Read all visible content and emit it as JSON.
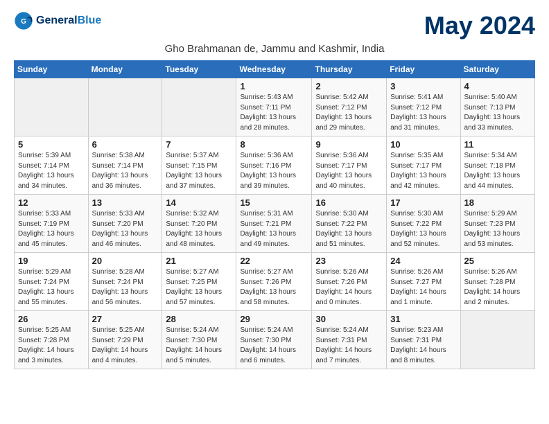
{
  "logo": {
    "general": "General",
    "blue": "Blue"
  },
  "title": "May 2024",
  "subtitle": "Gho Brahmanan de, Jammu and Kashmir, India",
  "days_of_week": [
    "Sunday",
    "Monday",
    "Tuesday",
    "Wednesday",
    "Thursday",
    "Friday",
    "Saturday"
  ],
  "weeks": [
    [
      {
        "day": "",
        "info": ""
      },
      {
        "day": "",
        "info": ""
      },
      {
        "day": "",
        "info": ""
      },
      {
        "day": "1",
        "info": "Sunrise: 5:43 AM\nSunset: 7:11 PM\nDaylight: 13 hours\nand 28 minutes."
      },
      {
        "day": "2",
        "info": "Sunrise: 5:42 AM\nSunset: 7:12 PM\nDaylight: 13 hours\nand 29 minutes."
      },
      {
        "day": "3",
        "info": "Sunrise: 5:41 AM\nSunset: 7:12 PM\nDaylight: 13 hours\nand 31 minutes."
      },
      {
        "day": "4",
        "info": "Sunrise: 5:40 AM\nSunset: 7:13 PM\nDaylight: 13 hours\nand 33 minutes."
      }
    ],
    [
      {
        "day": "5",
        "info": "Sunrise: 5:39 AM\nSunset: 7:14 PM\nDaylight: 13 hours\nand 34 minutes."
      },
      {
        "day": "6",
        "info": "Sunrise: 5:38 AM\nSunset: 7:14 PM\nDaylight: 13 hours\nand 36 minutes."
      },
      {
        "day": "7",
        "info": "Sunrise: 5:37 AM\nSunset: 7:15 PM\nDaylight: 13 hours\nand 37 minutes."
      },
      {
        "day": "8",
        "info": "Sunrise: 5:36 AM\nSunset: 7:16 PM\nDaylight: 13 hours\nand 39 minutes."
      },
      {
        "day": "9",
        "info": "Sunrise: 5:36 AM\nSunset: 7:17 PM\nDaylight: 13 hours\nand 40 minutes."
      },
      {
        "day": "10",
        "info": "Sunrise: 5:35 AM\nSunset: 7:17 PM\nDaylight: 13 hours\nand 42 minutes."
      },
      {
        "day": "11",
        "info": "Sunrise: 5:34 AM\nSunset: 7:18 PM\nDaylight: 13 hours\nand 44 minutes."
      }
    ],
    [
      {
        "day": "12",
        "info": "Sunrise: 5:33 AM\nSunset: 7:19 PM\nDaylight: 13 hours\nand 45 minutes."
      },
      {
        "day": "13",
        "info": "Sunrise: 5:33 AM\nSunset: 7:20 PM\nDaylight: 13 hours\nand 46 minutes."
      },
      {
        "day": "14",
        "info": "Sunrise: 5:32 AM\nSunset: 7:20 PM\nDaylight: 13 hours\nand 48 minutes."
      },
      {
        "day": "15",
        "info": "Sunrise: 5:31 AM\nSunset: 7:21 PM\nDaylight: 13 hours\nand 49 minutes."
      },
      {
        "day": "16",
        "info": "Sunrise: 5:30 AM\nSunset: 7:22 PM\nDaylight: 13 hours\nand 51 minutes."
      },
      {
        "day": "17",
        "info": "Sunrise: 5:30 AM\nSunset: 7:22 PM\nDaylight: 13 hours\nand 52 minutes."
      },
      {
        "day": "18",
        "info": "Sunrise: 5:29 AM\nSunset: 7:23 PM\nDaylight: 13 hours\nand 53 minutes."
      }
    ],
    [
      {
        "day": "19",
        "info": "Sunrise: 5:29 AM\nSunset: 7:24 PM\nDaylight: 13 hours\nand 55 minutes."
      },
      {
        "day": "20",
        "info": "Sunrise: 5:28 AM\nSunset: 7:24 PM\nDaylight: 13 hours\nand 56 minutes."
      },
      {
        "day": "21",
        "info": "Sunrise: 5:27 AM\nSunset: 7:25 PM\nDaylight: 13 hours\nand 57 minutes."
      },
      {
        "day": "22",
        "info": "Sunrise: 5:27 AM\nSunset: 7:26 PM\nDaylight: 13 hours\nand 58 minutes."
      },
      {
        "day": "23",
        "info": "Sunrise: 5:26 AM\nSunset: 7:26 PM\nDaylight: 14 hours\nand 0 minutes."
      },
      {
        "day": "24",
        "info": "Sunrise: 5:26 AM\nSunset: 7:27 PM\nDaylight: 14 hours\nand 1 minute."
      },
      {
        "day": "25",
        "info": "Sunrise: 5:26 AM\nSunset: 7:28 PM\nDaylight: 14 hours\nand 2 minutes."
      }
    ],
    [
      {
        "day": "26",
        "info": "Sunrise: 5:25 AM\nSunset: 7:28 PM\nDaylight: 14 hours\nand 3 minutes."
      },
      {
        "day": "27",
        "info": "Sunrise: 5:25 AM\nSunset: 7:29 PM\nDaylight: 14 hours\nand 4 minutes."
      },
      {
        "day": "28",
        "info": "Sunrise: 5:24 AM\nSunset: 7:30 PM\nDaylight: 14 hours\nand 5 minutes."
      },
      {
        "day": "29",
        "info": "Sunrise: 5:24 AM\nSunset: 7:30 PM\nDaylight: 14 hours\nand 6 minutes."
      },
      {
        "day": "30",
        "info": "Sunrise: 5:24 AM\nSunset: 7:31 PM\nDaylight: 14 hours\nand 7 minutes."
      },
      {
        "day": "31",
        "info": "Sunrise: 5:23 AM\nSunset: 7:31 PM\nDaylight: 14 hours\nand 8 minutes."
      },
      {
        "day": "",
        "info": ""
      }
    ]
  ]
}
